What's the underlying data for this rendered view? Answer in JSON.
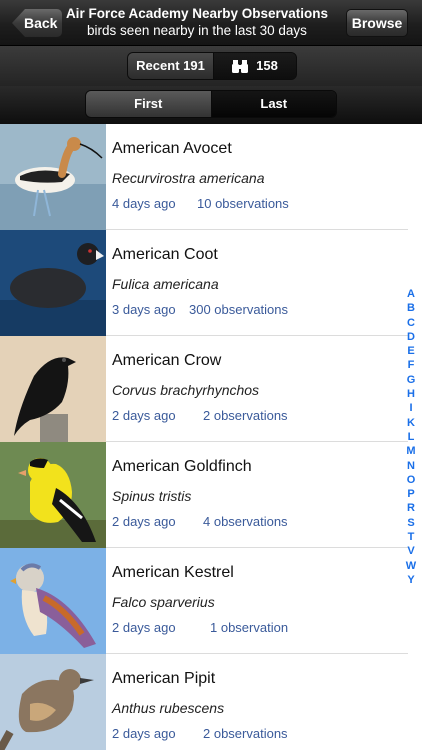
{
  "nav": {
    "title": "Air Force Academy Nearby Observations",
    "subtitle": "birds seen nearby in the last 30 days",
    "back_label": "Back",
    "browse_label": "Browse"
  },
  "filter": {
    "recent_label": "Recent 191",
    "binocular_count": "158"
  },
  "sort": {
    "first_label": "First",
    "last_label": "Last"
  },
  "birds": [
    {
      "name": "American Avocet",
      "scientific": "Recurvirostra americana",
      "ago": "4 days ago",
      "observations": "10 observations"
    },
    {
      "name": "American Coot",
      "scientific": "Fulica americana",
      "ago": "3 days ago",
      "observations": "300 observations"
    },
    {
      "name": "American Crow",
      "scientific": "Corvus brachyrhynchos",
      "ago": "2 days ago",
      "observations": "2 observations"
    },
    {
      "name": "American Goldfinch",
      "scientific": "Spinus tristis",
      "ago": "2 days ago",
      "observations": "4 observations"
    },
    {
      "name": "American Kestrel",
      "scientific": "Falco sparverius",
      "ago": "2 days ago",
      "observations": "1 observation"
    },
    {
      "name": "American Pipit",
      "scientific": "Anthus rubescens",
      "ago": "2 days ago",
      "observations": "2 observations"
    }
  ],
  "index_letters": [
    "A",
    "B",
    "C",
    "D",
    "E",
    "F",
    "G",
    "H",
    "I",
    "K",
    "L",
    "M",
    "N",
    "O",
    "P",
    "R",
    "S",
    "T",
    "V",
    "W",
    "Y"
  ]
}
